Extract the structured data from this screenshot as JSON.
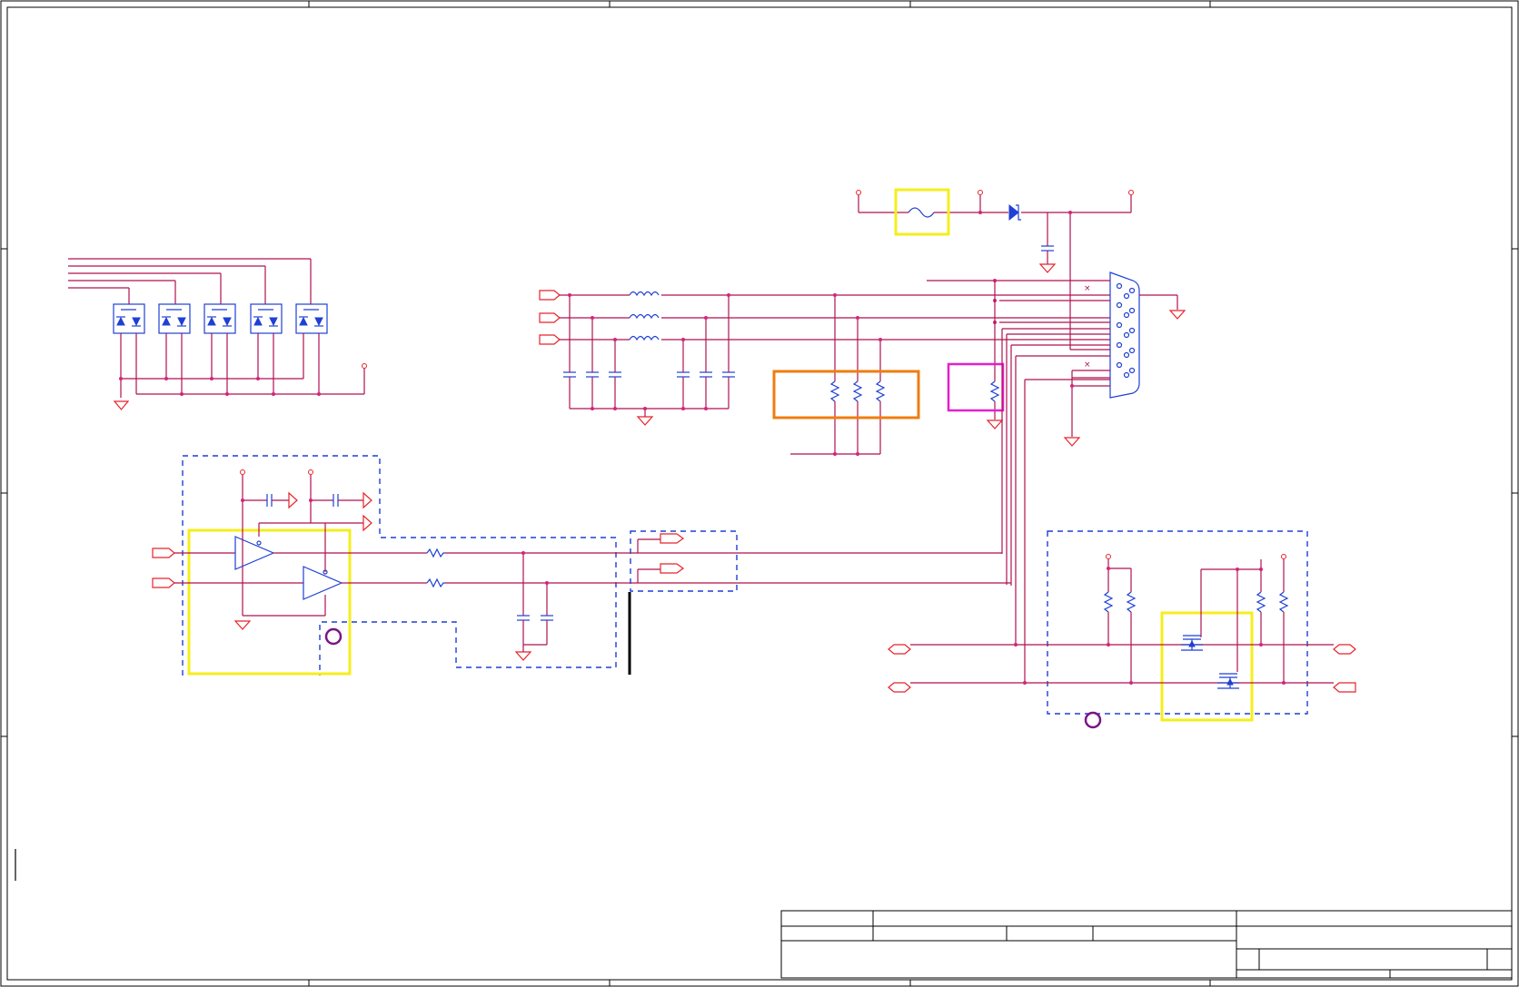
{
  "colors": {
    "wire": "#b0124f",
    "power_symbol": "#e8232a",
    "component": "#1f3fd6",
    "highlight_yellow": "#f5ee1c",
    "highlight_orange": "#f07c12",
    "highlight_magenta": "#e21fd0",
    "marker": "#7b1488"
  },
  "icons": {
    "tvs_diode_array": "tvs-diode-icon",
    "ferrite_bead": "ferrite-bead-icon",
    "capacitor": "capacitor-icon",
    "resistor": "resistor-icon",
    "ground": "ground-icon",
    "power_rail": "power-rail-icon",
    "opamp": "opamp-icon",
    "mosfet": "mosfet-icon",
    "connector": "db15-connector-icon",
    "fuse": "fuse-icon",
    "schottky_diode": "schottky-diode-icon",
    "port": "port-icon"
  },
  "title_block": {
    "row1_label": "",
    "row1_value": "",
    "row2_a": "",
    "row2_b": "",
    "row2_c": "",
    "notes": "",
    "company": "",
    "title": "",
    "size": "",
    "document_number": "",
    "sheet": ""
  }
}
